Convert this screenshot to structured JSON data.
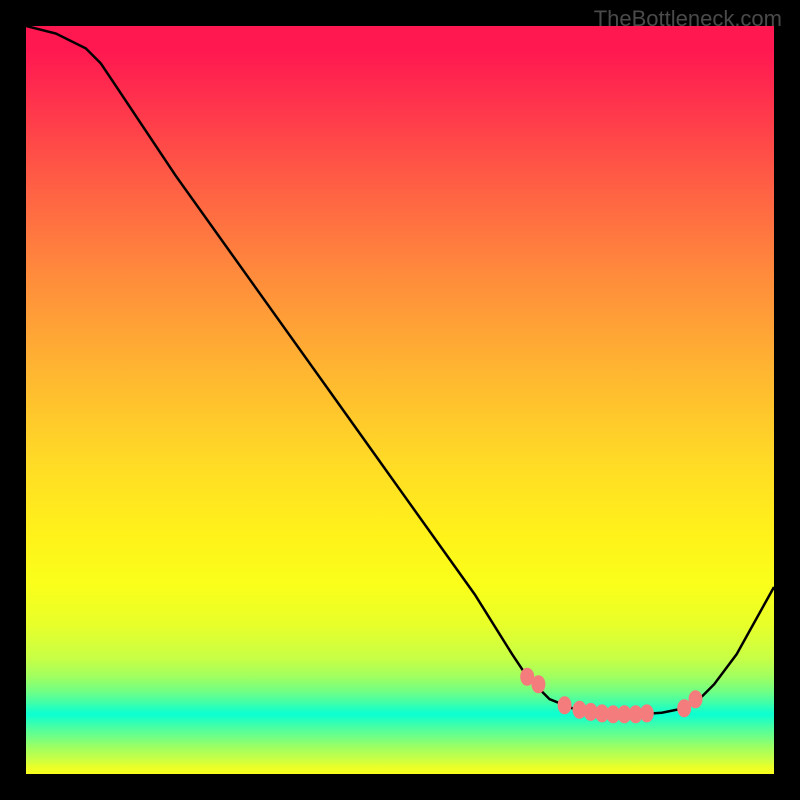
{
  "watermark": "TheBottleneck.com",
  "chart_data": {
    "type": "line",
    "title": "",
    "xlabel": "",
    "ylabel": "",
    "xlim": [
      0,
      100
    ],
    "ylim": [
      0,
      100
    ],
    "grid": false,
    "legend": false,
    "series": [
      {
        "name": "bottleneck-curve",
        "x": [
          0,
          4,
          8,
          10,
          12,
          20,
          30,
          40,
          50,
          60,
          65,
          67,
          70,
          73,
          76,
          79,
          82,
          85,
          88,
          90,
          92,
          95,
          100
        ],
        "y": [
          100,
          99,
          97,
          95,
          92,
          80,
          66,
          52,
          38,
          24,
          16,
          13,
          10,
          8.8,
          8.2,
          8.0,
          8.0,
          8.2,
          8.8,
          10,
          12,
          16,
          25
        ]
      }
    ],
    "markers": {
      "name": "bottleneck-points",
      "x": [
        67,
        68.5,
        72,
        74,
        75.5,
        77,
        78.5,
        80,
        81.5,
        83,
        88,
        89.5
      ],
      "y": [
        13,
        12,
        9.2,
        8.6,
        8.3,
        8.1,
        8.0,
        8.0,
        8.0,
        8.1,
        8.8,
        10
      ]
    },
    "colors": {
      "curve": "#000000",
      "markers": "#f47c7c",
      "gradient_top": "#ff1750",
      "gradient_mid": "#fff21a",
      "gradient_bottom": "#10ffce"
    }
  }
}
